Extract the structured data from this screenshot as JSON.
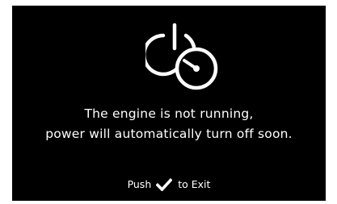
{
  "notice": {
    "icon": "power-timer-icon",
    "line1": "The engine is not running,",
    "line2": "power will automatically turn off soon."
  },
  "hint": {
    "prefix": "Push",
    "icon": "checkmark-icon",
    "suffix": "to Exit"
  },
  "colors": {
    "background": "#000000",
    "text": "#ffffff"
  }
}
